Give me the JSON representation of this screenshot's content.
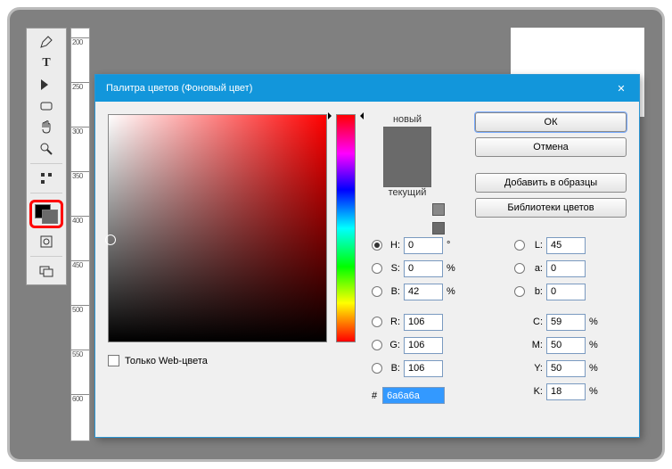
{
  "dialog": {
    "title": "Палитра цветов (Фоновый цвет)",
    "close": "✕",
    "new_label": "новый",
    "current_label": "текущий",
    "buttons": {
      "ok": "ОК",
      "cancel": "Отмена",
      "add": "Добавить в образцы",
      "libs": "Библиотеки цветов"
    },
    "hsb": {
      "h_label": "H:",
      "h": "0",
      "h_unit": "°",
      "s_label": "S:",
      "s": "0",
      "s_unit": "%",
      "b_label": "B:",
      "b": "42",
      "b_unit": "%"
    },
    "lab": {
      "l_label": "L:",
      "l": "45",
      "a_label": "a:",
      "a": "0",
      "b_label": "b:",
      "b": "0"
    },
    "rgb": {
      "r_label": "R:",
      "r": "106",
      "g_label": "G:",
      "g": "106",
      "b_label": "B:",
      "b": "106"
    },
    "cmyk": {
      "c_label": "C:",
      "c": "59",
      "m_label": "M:",
      "m": "50",
      "y_label": "Y:",
      "y": "50",
      "k_label": "K:",
      "k": "18",
      "unit": "%"
    },
    "hex_label": "#",
    "hex": "6a6a6a",
    "webonly": "Только Web-цвета"
  },
  "ruler": {
    "marks": [
      "200",
      "250",
      "300",
      "350",
      "400",
      "450",
      "500",
      "550",
      "600"
    ]
  }
}
